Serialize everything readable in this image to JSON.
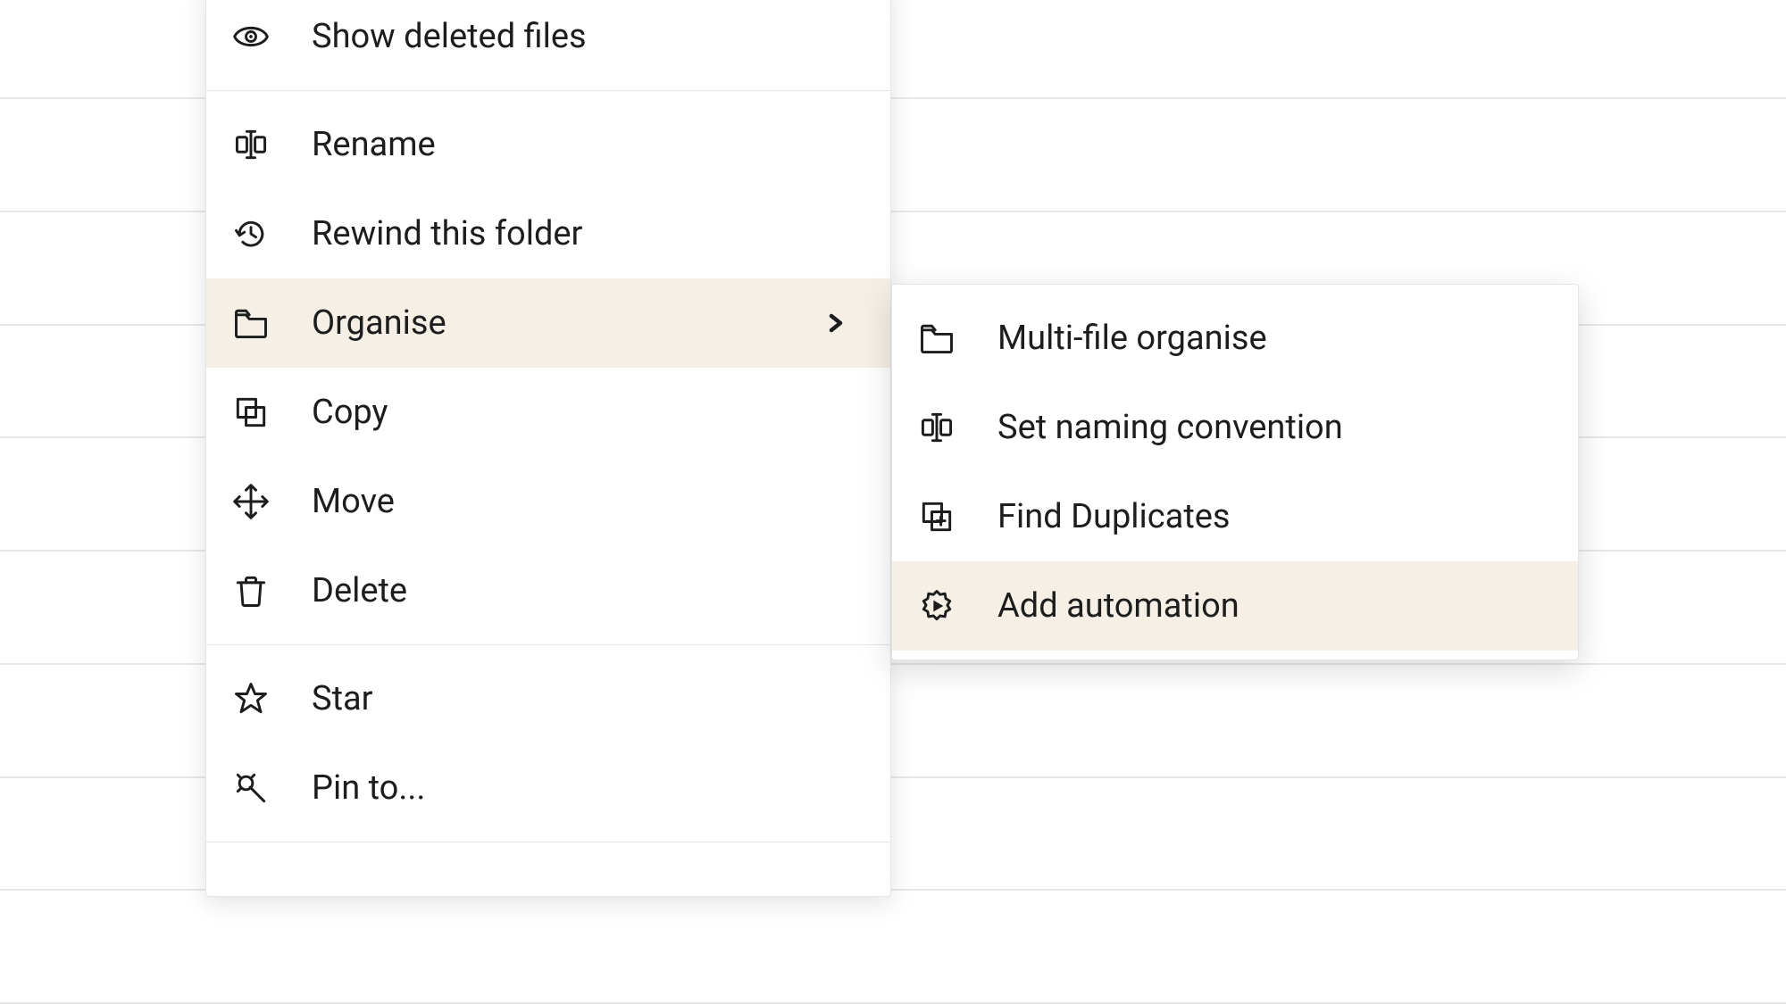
{
  "menu": {
    "sections": [
      {
        "items": [
          {
            "id": "show-deleted",
            "icon": "eye",
            "label": "Show deleted files"
          }
        ]
      },
      {
        "items": [
          {
            "id": "rename",
            "icon": "rename",
            "label": "Rename"
          },
          {
            "id": "rewind",
            "icon": "history",
            "label": "Rewind this folder"
          },
          {
            "id": "organise",
            "icon": "folder",
            "label": "Organise",
            "submenu": true,
            "highlight": true
          },
          {
            "id": "copy",
            "icon": "copy",
            "label": "Copy"
          },
          {
            "id": "move",
            "icon": "move",
            "label": "Move"
          },
          {
            "id": "delete",
            "icon": "trash",
            "label": "Delete"
          }
        ]
      },
      {
        "items": [
          {
            "id": "star",
            "icon": "star",
            "label": "Star"
          },
          {
            "id": "pin",
            "icon": "pin",
            "label": "Pin to..."
          }
        ]
      }
    ]
  },
  "submenu": {
    "items": [
      {
        "id": "multi-file",
        "icon": "folder",
        "label": "Multi-file organise"
      },
      {
        "id": "naming",
        "icon": "rename",
        "label": "Set naming convention"
      },
      {
        "id": "duplicates",
        "icon": "duplicate",
        "label": "Find Duplicates"
      },
      {
        "id": "automation",
        "icon": "automation",
        "label": "Add automation",
        "highlight": true
      }
    ]
  }
}
